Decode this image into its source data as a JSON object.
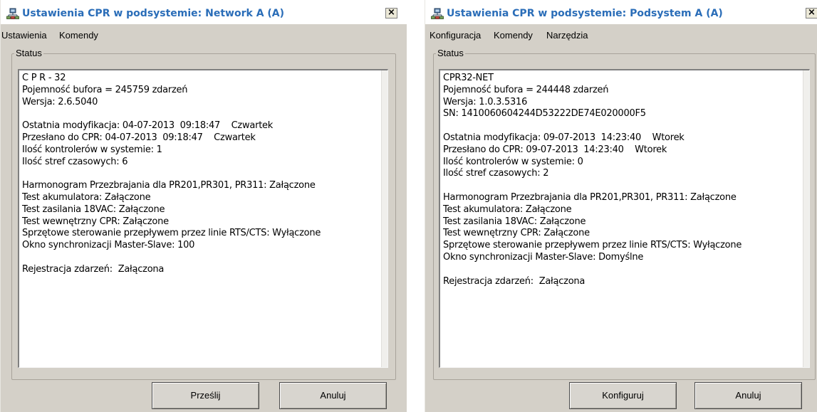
{
  "windows": [
    {
      "title": "Ustawienia CPR w podsystemie: Network A (A)",
      "close_glyph": "×",
      "icon": "network-icon",
      "menu": [
        "Ustawienia",
        "Komendy"
      ],
      "status_label": "Status",
      "status_lines": [
        "C P R - 32",
        "Pojemność bufora = 245759 zdarzeń",
        "Wersja: 2.6.5040",
        "",
        "Ostatnia modyfikacja: 04-07-2013  09:18:47    Czwartek",
        "Przesłano do CPR: 04-07-2013  09:18:47    Czwartek",
        "Ilość kontrolerów w systemie: 1",
        "Ilość stref czasowych: 6",
        "",
        "Harmonogram Przezbrajania dla PR201,PR301, PR311: Załączone",
        "Test akumulatora: Załączone",
        "Test zasilania 18VAC: Załączone",
        "Test wewnętrzny CPR: Załączone",
        "Sprzętowe sterowanie przepływem przez linie RTS/CTS: Wyłączone",
        "Okno synchronizacji Master-Slave: 100",
        "",
        "Rejestracja zdarzeń:  Załączona"
      ],
      "primary_button": "Prześlij",
      "cancel_button": "Anuluj"
    },
    {
      "title": "Ustawienia CPR w podsystemie: Podsystem A (A)",
      "close_glyph": "×",
      "icon": "network-icon",
      "menu": [
        "Konfiguracja",
        "Komendy",
        "Narzędzia"
      ],
      "status_label": "Status",
      "status_lines": [
        "CPR32-NET",
        "Pojemność bufora = 244448 zdarzeń",
        "Wersja: 1.0.3.5316",
        "SN: 1410060604244D53222DE74E020000F5",
        "",
        "Ostatnia modyfikacja: 09-07-2013  14:23:40    Wtorek",
        "Przesłano do CPR: 09-07-2013  14:23:40    Wtorek",
        "Ilość kontrolerów w systemie: 0",
        "Ilość stref czasowych: 2",
        "",
        "Harmonogram Przezbrajania dla PR201,PR301, PR311: Załączone",
        "Test akumulatora: Załączone",
        "Test zasilania 18VAC: Załączone",
        "Test wewnętrzny CPR: Załączone",
        "Sprzętowe sterowanie przepływem przez linie RTS/CTS: Wyłączone",
        "Okno synchronizacji Master-Slave: Domyślne",
        "",
        "Rejestracja zdarzeń:  Załączona"
      ],
      "primary_button": "Konfiguruj",
      "cancel_button": "Anuluj"
    }
  ]
}
